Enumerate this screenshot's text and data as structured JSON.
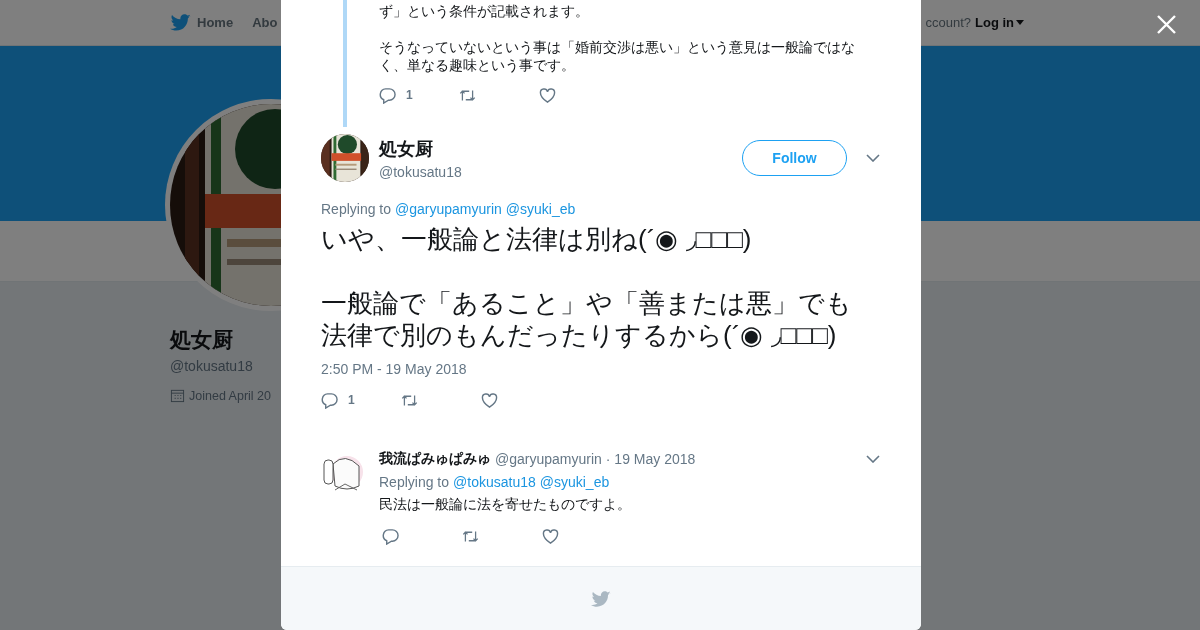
{
  "page": {
    "nav": {
      "items": [
        {
          "label": "Home"
        },
        {
          "label": "Abo"
        }
      ],
      "account_prompt": "ccount?",
      "login": "Log in"
    },
    "profile": {
      "name": "処女厨",
      "handle": "@tokusatu18",
      "joined": "Joined April 20"
    }
  },
  "modal": {
    "parent_tweet": {
      "paragraphs": [
        "ず」という条件が記載されます。",
        "そうなっていないという事は「婚前交渉は悪い」という意見は一般論ではなく、単なる趣味という事です。"
      ],
      "reply_count": "1"
    },
    "tweet": {
      "name": "処女厨",
      "handle": "@tokusatu18",
      "follow_label": "Follow",
      "replying_label": "Replying to",
      "replying_to": [
        "@garyupamyurin",
        "@syuki_eb"
      ],
      "paragraphs": [
        "いや、一般論と法律は別ね(´◉ ◞□□□)",
        "一般論で「あること」や「善または悪」でも法律で別のもんだったりするから(´◉ ◞□□□)"
      ],
      "timestamp": "2:50 PM - 19 May 2018",
      "reply_count": "1"
    },
    "replies": [
      {
        "name": "我流ぱみゅぱみゅ",
        "handle": "@garyupamyurin",
        "date": "· 19 May 2018",
        "replying_label": "Replying to",
        "replying_to": [
          "@tokusatu18",
          "@syuki_eb"
        ],
        "text": "民法は一般論に法を寄せたものですよ。"
      }
    ]
  }
}
